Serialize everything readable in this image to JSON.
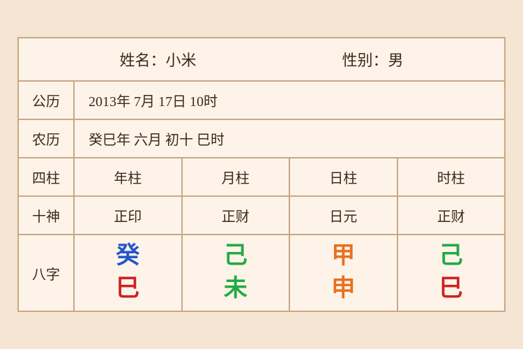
{
  "header": {
    "name_label": "姓名：小米",
    "gender_label": "性别：男"
  },
  "solar": {
    "label": "公历",
    "value": "2013年 7月 17日 10时"
  },
  "lunar": {
    "label": "农历",
    "value": "癸巳年 六月 初十 巳时"
  },
  "sizhui_row": {
    "label": "四柱",
    "columns": [
      "年柱",
      "月柱",
      "日柱",
      "时柱"
    ]
  },
  "shishen_row": {
    "label": "十神",
    "columns": [
      "正印",
      "正财",
      "日元",
      "正财"
    ]
  },
  "bazhi_row": {
    "label": "八字",
    "columns": [
      {
        "top": "癸",
        "top_color": "color-blue",
        "bottom": "巳",
        "bottom_color": "color-red"
      },
      {
        "top": "己",
        "top_color": "color-green",
        "bottom": "未",
        "bottom_color": "color-green"
      },
      {
        "top": "甲",
        "top_color": "color-orange",
        "bottom": "申",
        "bottom_color": "color-orange"
      },
      {
        "top": "己",
        "top_color": "color-green2",
        "bottom": "巳",
        "bottom_color": "color-red"
      }
    ]
  }
}
